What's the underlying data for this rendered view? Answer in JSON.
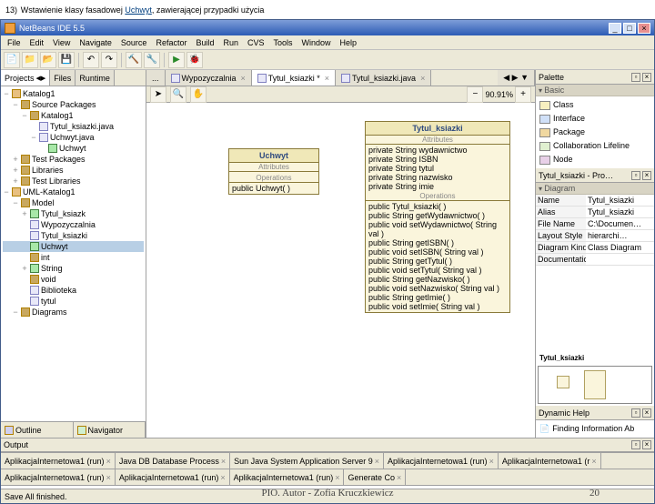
{
  "slide": {
    "num": "13)",
    "text": "Wstawienie klasy fasadowej ",
    "hl": "Uchwyt",
    "text2": ", zawierającej przypadki użycia"
  },
  "app_title": "NetBeans IDE 5.5",
  "menu": [
    "File",
    "Edit",
    "View",
    "Navigate",
    "Source",
    "Refactor",
    "Build",
    "Run",
    "CVS",
    "Tools",
    "Window",
    "Help"
  ],
  "left": {
    "tabs": [
      "Projects",
      "Files",
      "Runtime"
    ],
    "tree": [
      {
        "t": "Katalog1",
        "i": 0,
        "e": "−",
        "c": "db"
      },
      {
        "t": "Source Packages",
        "i": 1,
        "e": "−",
        "c": "pkg"
      },
      {
        "t": "Katalog1",
        "i": 2,
        "e": "−",
        "c": "pkg"
      },
      {
        "t": "Tytul_ksiazki.java",
        "i": 3,
        "e": "",
        "c": "file"
      },
      {
        "t": "Uchwyt.java",
        "i": 3,
        "e": "−",
        "c": "file"
      },
      {
        "t": "Uchwyt",
        "i": 4,
        "e": "",
        "c": "cls"
      },
      {
        "t": "Test Packages",
        "i": 1,
        "e": "+",
        "c": "pkg"
      },
      {
        "t": "Libraries",
        "i": 1,
        "e": "+",
        "c": "pkg"
      },
      {
        "t": "Test Libraries",
        "i": 1,
        "e": "+",
        "c": "pkg"
      },
      {
        "t": "UML-Katalog1",
        "i": 0,
        "e": "−",
        "c": "db"
      },
      {
        "t": "Model",
        "i": 1,
        "e": "−",
        "c": "pkg"
      },
      {
        "t": "Tytul_ksiazk",
        "i": 2,
        "e": "+",
        "c": "cls"
      },
      {
        "t": "Wypozyczalnia",
        "i": 2,
        "e": "",
        "c": "file"
      },
      {
        "t": "Tytul_ksiazki",
        "i": 2,
        "e": "",
        "c": "file"
      },
      {
        "t": "Uchwyt",
        "i": 2,
        "e": "",
        "c": "cls",
        "sel": true
      },
      {
        "t": "int",
        "i": 2,
        "e": "",
        "c": "pkg"
      },
      {
        "t": "String",
        "i": 2,
        "e": "+",
        "c": "cls"
      },
      {
        "t": "void",
        "i": 2,
        "e": "",
        "c": "pkg"
      },
      {
        "t": "Biblioteka",
        "i": 2,
        "e": "",
        "c": "file"
      },
      {
        "t": "tytul",
        "i": 2,
        "e": "",
        "c": "file"
      },
      {
        "t": "Diagrams",
        "i": 1,
        "e": "−",
        "c": "pkg"
      }
    ]
  },
  "editor": {
    "tabs": [
      {
        "label": "...",
        "active": false
      },
      {
        "label": "Wypozyczalnia",
        "active": false
      },
      {
        "label": "Tytul_ksiazki *",
        "active": true
      },
      {
        "label": "Tytul_ksiazki.java",
        "active": false
      }
    ],
    "zoom": "90.91%"
  },
  "uml": {
    "uchwyt": {
      "title": "Uchwyt",
      "attrs_label": "Attributes",
      "ops_label": "Operations",
      "ops": [
        "public Uchwyt( )"
      ]
    },
    "tytul": {
      "title": "Tytul_ksiazki",
      "attrs_label": "Attributes",
      "attrs": [
        "private String wydawnictwo",
        "private String ISBN",
        "private String tytul",
        "private String nazwisko",
        "private String imie"
      ],
      "ops_label": "Operations",
      "ops": [
        "public Tytul_ksiazki( )",
        "public String getWydawnictwo( )",
        "public void setWydawnictwo( String val )",
        "public String getISBN( )",
        "public void setISBN( String val )",
        "public String getTytul( )",
        "public void setTytul( String val )",
        "public String getNazwisko( )",
        "public void setNazwisko( String val )",
        "public String getImie( )",
        "public void setImie( String val )"
      ]
    }
  },
  "palette": {
    "title": "Palette",
    "cat": "Basic",
    "items": [
      {
        "label": "Class",
        "c": "cls"
      },
      {
        "label": "Interface",
        "c": "intf"
      },
      {
        "label": "Package",
        "c": "pkg"
      },
      {
        "label": "Collaboration Lifeline",
        "c": "collab"
      },
      {
        "label": "Node",
        "c": "node"
      }
    ]
  },
  "props": {
    "title": "Tytul_ksiazki - Pro…",
    "cat": "Diagram",
    "rows": [
      {
        "k": "Name",
        "v": "Tytul_ksiazki"
      },
      {
        "k": "Alias",
        "v": "Tytul_ksiazki"
      },
      {
        "k": "File Name",
        "v": "C:\\Documen…"
      },
      {
        "k": "Layout Style",
        "v": "hierarchi…"
      },
      {
        "k": "Diagram Kind",
        "v": "Class Diagram"
      },
      {
        "k": "Documentation",
        "v": ""
      }
    ],
    "preview": "Tytul_ksiazki"
  },
  "help": {
    "title": "Dynamic Help",
    "item": "Finding Information Ab"
  },
  "bottom_tabs": [
    "Outline",
    "Navigator"
  ],
  "output": {
    "title": "Output",
    "tabs": [
      "AplikacjaInternetowa1 (run)",
      "Java DB Database Process",
      "Sun Java System Application Server 9",
      "AplikacjaInternetowa1 (run)",
      "AplikacjaInternetowa1 (r"
    ],
    "tabs2": [
      "AplikacjaInternetowa1 (run)",
      "AplikacjaInternetowa1 (run)",
      "AplikacjaInternetowa1 (run)",
      "Generate Co"
    ]
  },
  "credit": "PIO. Autor - Zofia Kruczkiewicz",
  "status": "Save All finished.",
  "pagenum": "20"
}
